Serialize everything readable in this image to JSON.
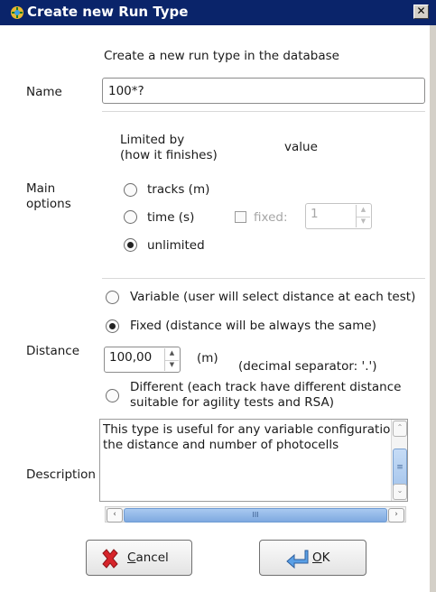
{
  "window": {
    "title": "Create new Run Type",
    "close_glyph": "✕"
  },
  "header": {
    "subtitle": "Create a new run type in the database"
  },
  "name": {
    "label": "Name",
    "value": "100*?"
  },
  "main_options": {
    "label_line1": "Main",
    "label_line2": "options",
    "limited_by_line1": "Limited by",
    "limited_by_line2": "(how it finishes)",
    "value_header": "value",
    "options": [
      {
        "label": "tracks (m)",
        "selected": false
      },
      {
        "label": "time (s)",
        "selected": false
      },
      {
        "label": "unlimited",
        "selected": true
      }
    ],
    "fixed_label": "fixed:",
    "fixed_checked": false,
    "fixed_value": "1"
  },
  "distance": {
    "label": "Distance",
    "variable_label": "Variable (user will select distance at each test)",
    "fixed_label": "Fixed (distance will be always the same)",
    "value": "100,00",
    "unit": "(m)",
    "decimal_note": "(decimal separator: '.')",
    "different_line1": "Different (each track have different distance",
    "different_line2": "suitable for agility tests and RSA)",
    "selected": "fixed"
  },
  "description": {
    "label": "Description",
    "line1": "This type is useful for any variable configuratior",
    "line2": "the distance and number of photocells"
  },
  "buttons": {
    "cancel_mnemonic": "C",
    "cancel_rest": "ancel",
    "ok_mnemonic": "O",
    "ok_rest": "K"
  },
  "scroll": {
    "up_glyph": "⌃",
    "down_glyph": "⌄",
    "left_glyph": "‹",
    "right_glyph": "›",
    "grip_glyph": "III"
  },
  "icons": {
    "app": "app-icon",
    "cancel": "cancel-x-icon",
    "ok": "ok-arrow-icon"
  }
}
